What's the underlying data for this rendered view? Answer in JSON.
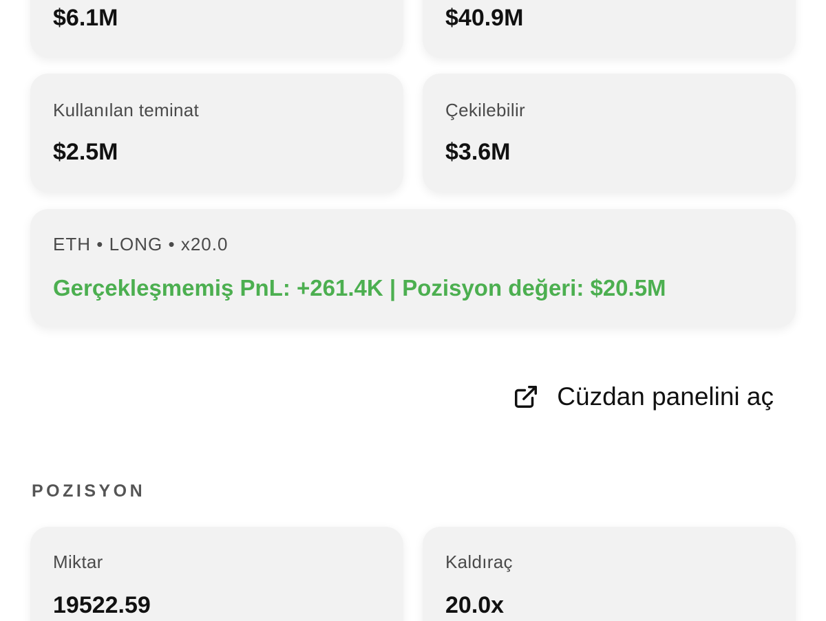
{
  "summary": {
    "top_left_value": "$6.1M",
    "top_right_value": "$40.9M",
    "used_margin": {
      "label": "Kullanılan teminat",
      "value": "$2.5M"
    },
    "withdrawable": {
      "label": "Çekilebilir",
      "value": "$3.6M"
    }
  },
  "position_card": {
    "asset": "ETH",
    "side": "LONG",
    "leverage": "x20.0",
    "separator": "•",
    "pnl_text": "Gerçekleşmemiş PnL: +261.4K  |  Pozisyon değeri: $20.5M",
    "pnl_color": "#4caf50"
  },
  "wallet_link": {
    "label": "Cüzdan panelini aç",
    "icon": "external-link-icon"
  },
  "position_section": {
    "title": "POZISYON",
    "amount": {
      "label": "Miktar",
      "value": "19522.59"
    },
    "leverage": {
      "label": "Kaldıraç",
      "value": "20.0x"
    }
  }
}
